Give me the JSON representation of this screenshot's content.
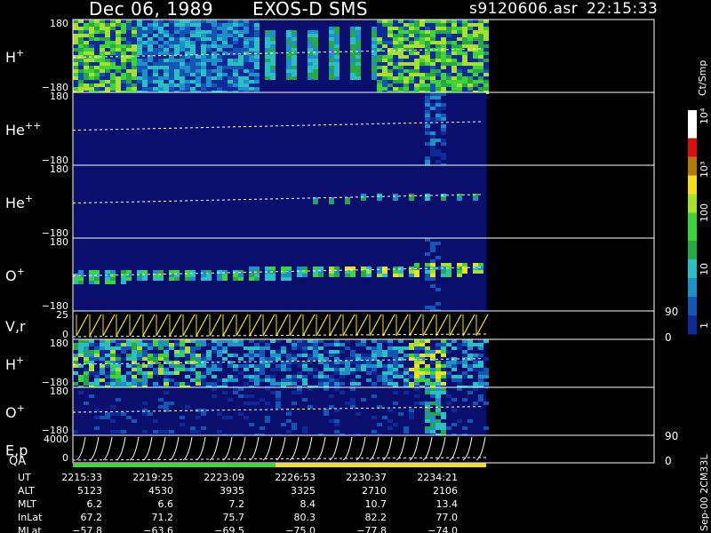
{
  "header": {
    "date": "Dec 06, 1989",
    "instrument": "EXOS-D SMS",
    "filename": "s9120606.asr",
    "time": "22:15:33"
  },
  "colorbar": {
    "unit": "Ct/Smp",
    "ticks": [
      "10⁴",
      "10³",
      "100",
      "10",
      "1"
    ]
  },
  "footer_note": "Sep-00 2CM33L",
  "chart_data": [
    {
      "type": "heatmap",
      "panel": "H+ pitch angle",
      "ylabel_main": "H",
      "ylabel_sup": "+",
      "yticks": [
        "180",
        "−180"
      ],
      "ylim": [
        -180,
        180
      ],
      "colormap": "spectral"
    },
    {
      "type": "heatmap",
      "panel": "He++ pitch angle",
      "ylabel_main": "He",
      "ylabel_sup": "++",
      "yticks": [
        "180",
        "−180"
      ],
      "ylim": [
        -180,
        180
      ]
    },
    {
      "type": "heatmap",
      "panel": "He+ pitch angle",
      "ylabel_main": "He",
      "ylabel_sup": "+",
      "yticks": [
        "180",
        "−180"
      ],
      "ylim": [
        -180,
        180
      ]
    },
    {
      "type": "heatmap",
      "panel": "O+ pitch angle",
      "ylabel_main": "O",
      "ylabel_sup": "+",
      "yticks": [
        "180",
        "−180"
      ],
      "ylim": [
        -180,
        180
      ]
    },
    {
      "type": "line",
      "panel": "V,r",
      "ylabel_main": "V,r",
      "yticks_left": [
        "25",
        "0"
      ],
      "yticks_right": [
        "90",
        "0"
      ],
      "ylim": [
        0,
        25
      ]
    },
    {
      "type": "heatmap",
      "panel": "H+ second",
      "ylabel_main": "H",
      "ylabel_sup": "+",
      "yticks": [
        "180",
        "−180"
      ],
      "ylim": [
        -180,
        180
      ]
    },
    {
      "type": "heatmap",
      "panel": "O+ second",
      "ylabel_main": "O",
      "ylabel_sup": "+",
      "yticks": [
        "180",
        "−180"
      ],
      "ylim": [
        -180,
        180
      ]
    },
    {
      "type": "line",
      "panel": "E,p",
      "ylabel_main": "E,p",
      "yticks_left": [
        "4000",
        "0"
      ],
      "yticks_right": [
        "90",
        "0"
      ],
      "ylim": [
        0,
        4000
      ]
    }
  ],
  "qa": {
    "label": "QA",
    "segments": [
      {
        "from": 0,
        "to": 0.49,
        "color": "#33dd33"
      },
      {
        "from": 0.49,
        "to": 1,
        "color": "#f0e020"
      }
    ]
  },
  "table": {
    "rows": [
      {
        "label": "UT",
        "values": [
          "2215:33",
          "2219:25",
          "2223:09",
          "2226:53",
          "2230:37",
          "2234:21"
        ]
      },
      {
        "label": "ALT",
        "values": [
          "5123",
          "4530",
          "3935",
          "3325",
          "2710",
          "2106"
        ]
      },
      {
        "label": "MLT",
        "values": [
          "6.2",
          "6.6",
          "7.2",
          "8.4",
          "10.7",
          "13.4"
        ]
      },
      {
        "label": "InLat",
        "values": [
          "67.2",
          "71.2",
          "75.7",
          "80.3",
          "82.2",
          "77.0"
        ]
      },
      {
        "label": "MLat",
        "values": [
          "−57.8",
          "−63.6",
          "−69.5",
          "−75.0",
          "−77.8",
          "−74.0"
        ]
      }
    ]
  }
}
